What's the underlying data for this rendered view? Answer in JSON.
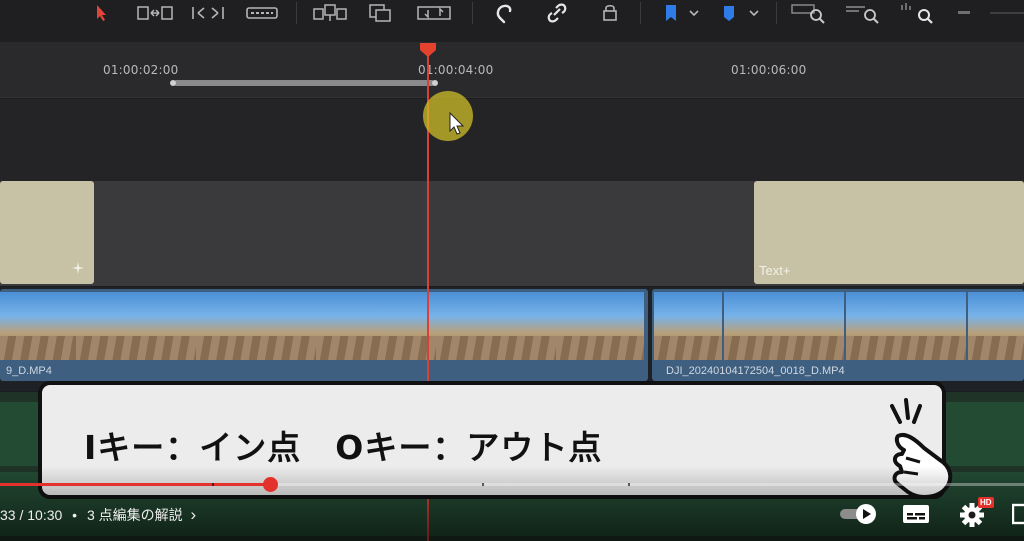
{
  "timeline": {
    "ruler_ticks": [
      "01:00:02:00",
      "01:00:04:00",
      "01:00:06:00"
    ],
    "title_clip_label": "Text+",
    "video_clip_1_name": "9_D.MP4",
    "video_clip_2_name": "DJI_20240104172504_0018_D.MP4"
  },
  "caption": {
    "text": "Iキー：イン点　Oキー：アウト点"
  },
  "player": {
    "time": "33 / 10:30",
    "separator": "•",
    "chapter": "3 点編集の解説",
    "chapter_arrow": "›",
    "hd_badge": "HD",
    "progress": 0.264,
    "accent_color": "#e5312b"
  },
  "icons": {
    "toolbar": [
      "select-pointer-icon",
      "trim-icon",
      "dynamic-trim-icon",
      "blade-icon",
      "insert-clip-icon",
      "overwrite-clip-icon",
      "replace-clip-icon",
      "snapping-icon",
      "linked-selection-icon",
      "position-lock-icon",
      "flag-icon",
      "marker-icon",
      "zoom-full-icon",
      "zoom-detail-icon",
      "zoom-custom-icon"
    ],
    "player": [
      "autoplay-toggle-icon",
      "subtitles-icon",
      "settings-icon",
      "fullscreen-icon"
    ]
  }
}
